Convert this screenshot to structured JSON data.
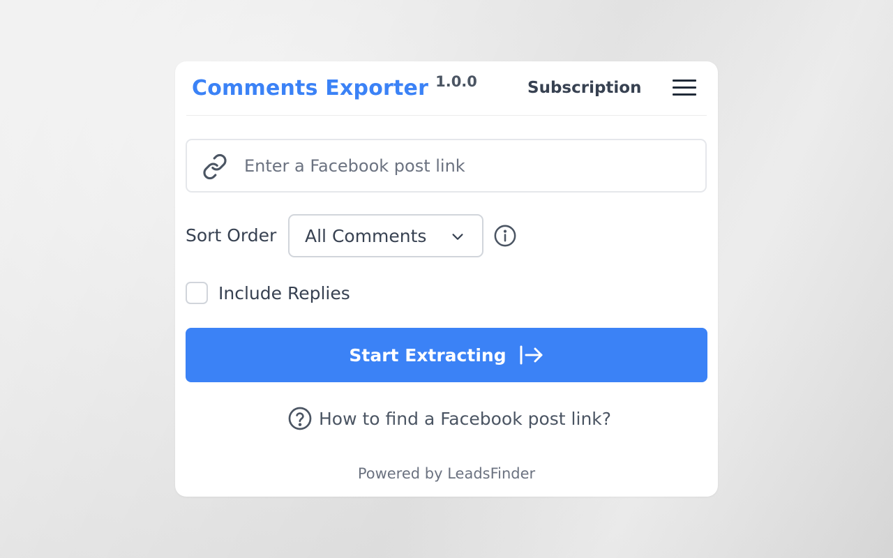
{
  "header": {
    "title": "Comments Exporter",
    "version": "1.0.0",
    "subscription_label": "Subscription",
    "menu_icon": "hamburger-menu-icon"
  },
  "link_field": {
    "icon": "link-icon",
    "placeholder": "Enter a Facebook post link",
    "value": ""
  },
  "sort": {
    "label": "Sort Order",
    "selected": "All Comments",
    "dropdown_icon": "chevron-down-icon",
    "info_icon": "info-icon"
  },
  "replies": {
    "label": "Include Replies",
    "checked": false
  },
  "start_button": {
    "label": "Start Extracting",
    "icon": "arrow-right-to-line-icon"
  },
  "help": {
    "icon": "question-circle-icon",
    "label": "How to find a Facebook post link?"
  },
  "footer": {
    "text": "Powered by LeadsFinder"
  },
  "colors": {
    "accent": "#3b82f6",
    "text": "#374151",
    "muted": "#6b7280",
    "border": "#e5e7eb"
  }
}
